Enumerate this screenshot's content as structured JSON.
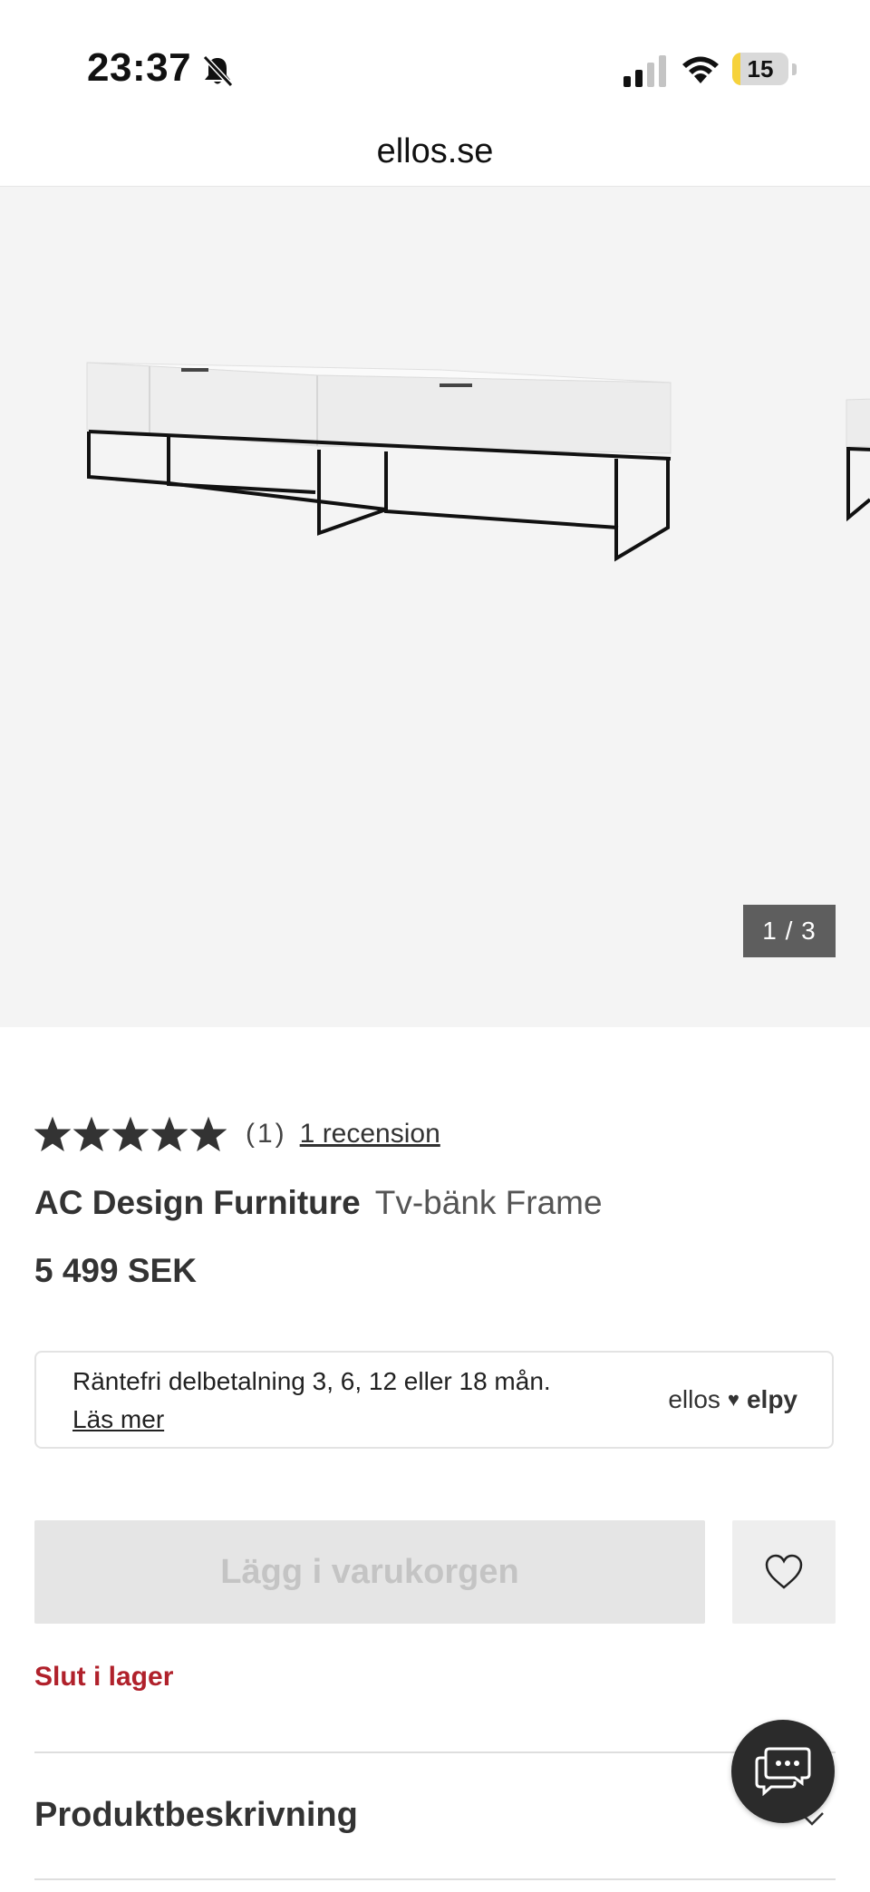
{
  "status_bar": {
    "time": "23:37",
    "battery_level": "15",
    "battery_percent": 0.15,
    "colors": {
      "battery_fill": "#f6d23b"
    }
  },
  "browser": {
    "url": "ellos.se"
  },
  "gallery": {
    "counter": "1 / 3",
    "current_image": 1,
    "total_images": 3
  },
  "rating": {
    "stars": 5,
    "max_stars": 5,
    "count_text": "(1)",
    "review_link": "1 recension"
  },
  "product": {
    "brand": "AC Design Furniture",
    "name": "Tv-bänk Frame",
    "price": "5 499 SEK"
  },
  "payment": {
    "text": "Räntefri delbetalning 3, 6, 12 eller 18 mån.",
    "link": "Läs mer",
    "logo_left": "ellos",
    "logo_right": "elpy"
  },
  "actions": {
    "add_to_cart": "Lägg i varukorgen",
    "wishlist_icon": "heart-icon"
  },
  "stock_status": {
    "text": "Slut i lager",
    "color": "#b0212b"
  },
  "sections": {
    "description_title": "Produktbeskrivning"
  },
  "chat": {
    "icon": "chat-bubble-icon"
  }
}
